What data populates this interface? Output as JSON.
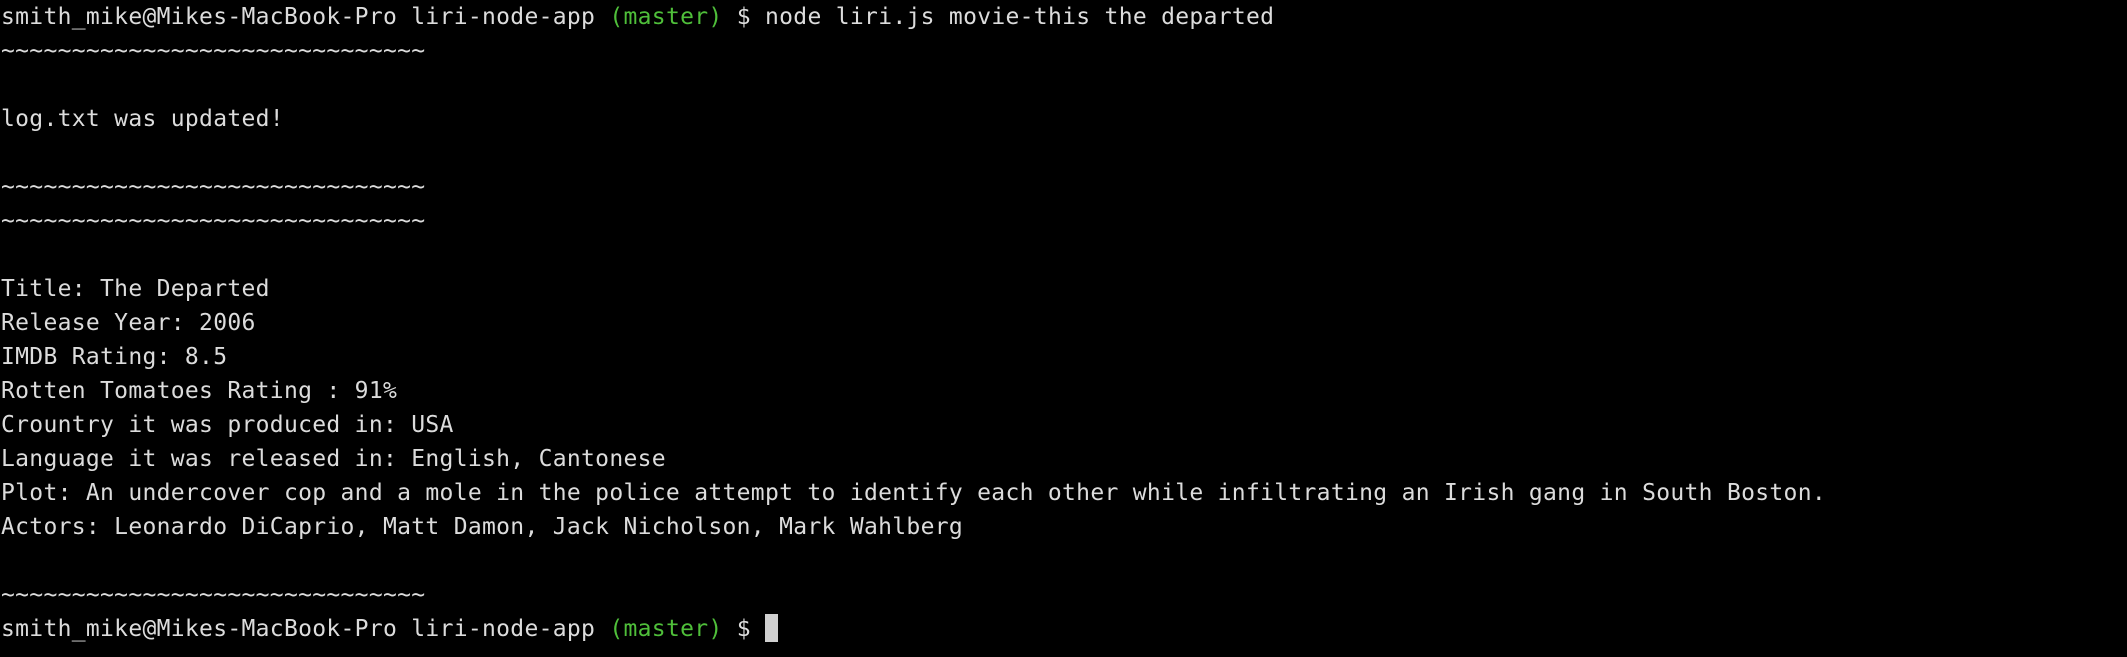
{
  "colors": {
    "background": "#000000",
    "text": "#dcdcdc",
    "git_branch": "#4fbf3a",
    "cursor": "#d0d0d0"
  },
  "prompt1": {
    "user_host": "smith_mike@Mikes-MacBook-Pro",
    "directory": "liri-node-app",
    "branch": "(master)",
    "symbol": "$",
    "command": "node liri.js movie-this the departed"
  },
  "output": {
    "separator_1": "~~~~~~~~~~~~~~~~~~~~~~~~~~~~~~",
    "log_message": "log.txt was updated!",
    "separator_2": "~~~~~~~~~~~~~~~~~~~~~~~~~~~~~~",
    "separator_3": "~~~~~~~~~~~~~~~~~~~~~~~~~~~~~~",
    "title": "Title: The Departed",
    "release_year": "Release Year: 2006",
    "imdb_rating": "IMDB Rating: 8.5",
    "rotten_tomatoes": "Rotten Tomatoes Rating : 91%",
    "country": "Crountry it was produced in: USA",
    "language": "Language it was released in: English, Cantonese",
    "plot": "Plot: An undercover cop and a mole in the police attempt to identify each other while infiltrating an Irish gang in South Boston.",
    "actors": "Actors: Leonardo DiCaprio, Matt Damon, Jack Nicholson, Mark Wahlberg",
    "separator_4": "~~~~~~~~~~~~~~~~~~~~~~~~~~~~~~"
  },
  "prompt2": {
    "user_host": "smith_mike@Mikes-MacBook-Pro",
    "directory": "liri-node-app",
    "branch": "(master)",
    "symbol": "$"
  }
}
